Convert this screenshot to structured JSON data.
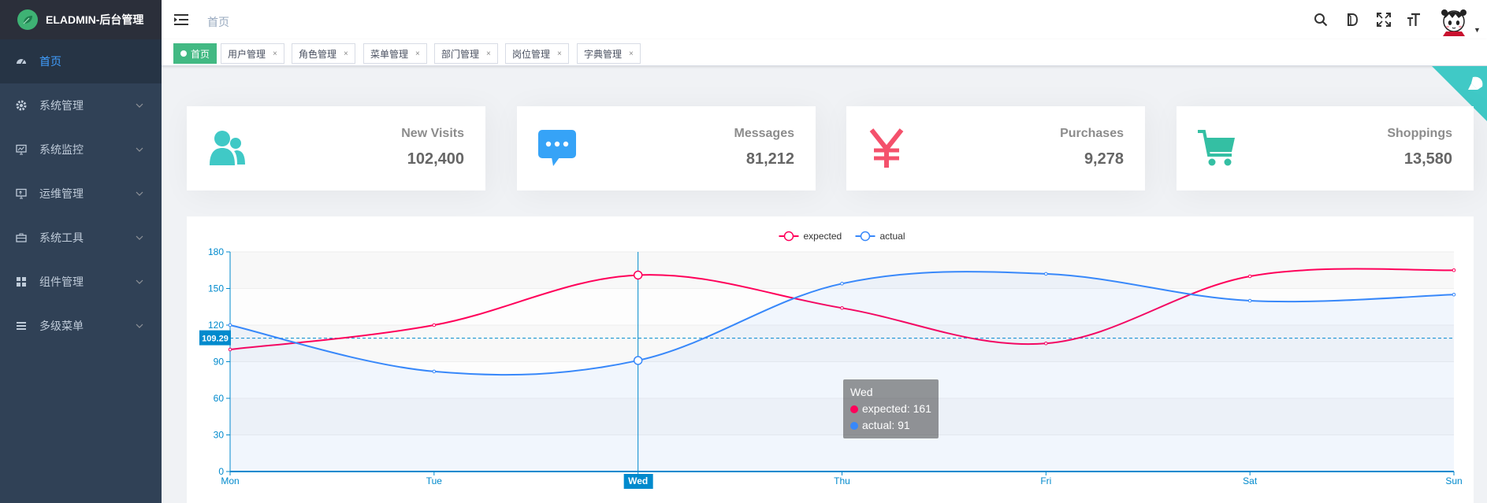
{
  "app": {
    "title": "ELADMIN-后台管理"
  },
  "sidebar": {
    "items": [
      {
        "label": "首页",
        "icon": "dashboard-icon",
        "active": true
      },
      {
        "label": "系统管理",
        "icon": "gear-icon"
      },
      {
        "label": "系统监控",
        "icon": "monitor-icon"
      },
      {
        "label": "运维管理",
        "icon": "ops-icon"
      },
      {
        "label": "系统工具",
        "icon": "toolbox-icon"
      },
      {
        "label": "组件管理",
        "icon": "grid-icon"
      },
      {
        "label": "多级菜单",
        "icon": "list-icon"
      }
    ]
  },
  "navbar": {
    "breadcrumb": "首页"
  },
  "tags": [
    {
      "label": "首页",
      "active": true
    },
    {
      "label": "用户管理",
      "close": "×"
    },
    {
      "label": "角色管理",
      "close": "×"
    },
    {
      "label": "菜单管理",
      "close": "×"
    },
    {
      "label": "部门管理",
      "close": "×"
    },
    {
      "label": "岗位管理",
      "close": "×"
    },
    {
      "label": "字典管理",
      "close": "×"
    }
  ],
  "cards": [
    {
      "label": "New Visits",
      "value": "102,400",
      "icon": "people-icon",
      "color": "#40c9c6"
    },
    {
      "label": "Messages",
      "value": "81,212",
      "icon": "message-icon",
      "color": "#36a3f7"
    },
    {
      "label": "Purchases",
      "value": "9,278",
      "icon": "yen-icon",
      "color": "#f4516c"
    },
    {
      "label": "Shoppings",
      "value": "13,580",
      "icon": "cart-icon",
      "color": "#34bfa3"
    }
  ],
  "chart_data": {
    "type": "line",
    "categories": [
      "Mon",
      "Tue",
      "Wed",
      "Thu",
      "Fri",
      "Sat",
      "Sun"
    ],
    "series": [
      {
        "name": "expected",
        "values": [
          100,
          120,
          161,
          134,
          105,
          160,
          165
        ],
        "color": "#ff005a"
      },
      {
        "name": "actual",
        "values": [
          120,
          82,
          91,
          154,
          162,
          140,
          145
        ],
        "color": "#3888fa"
      }
    ],
    "ylim": [
      0,
      180
    ],
    "yticks": [
      0,
      30,
      60,
      90,
      120,
      150,
      180
    ],
    "legend_position": "top-center",
    "grid": true,
    "axis_pointer": {
      "category": "Wed",
      "y_value": "109.29"
    },
    "tooltip": {
      "title": "Wed",
      "rows": [
        {
          "text": "expected: 161",
          "color": "#ff005a"
        },
        {
          "text": "actual: 91",
          "color": "#3888fa"
        }
      ]
    }
  }
}
